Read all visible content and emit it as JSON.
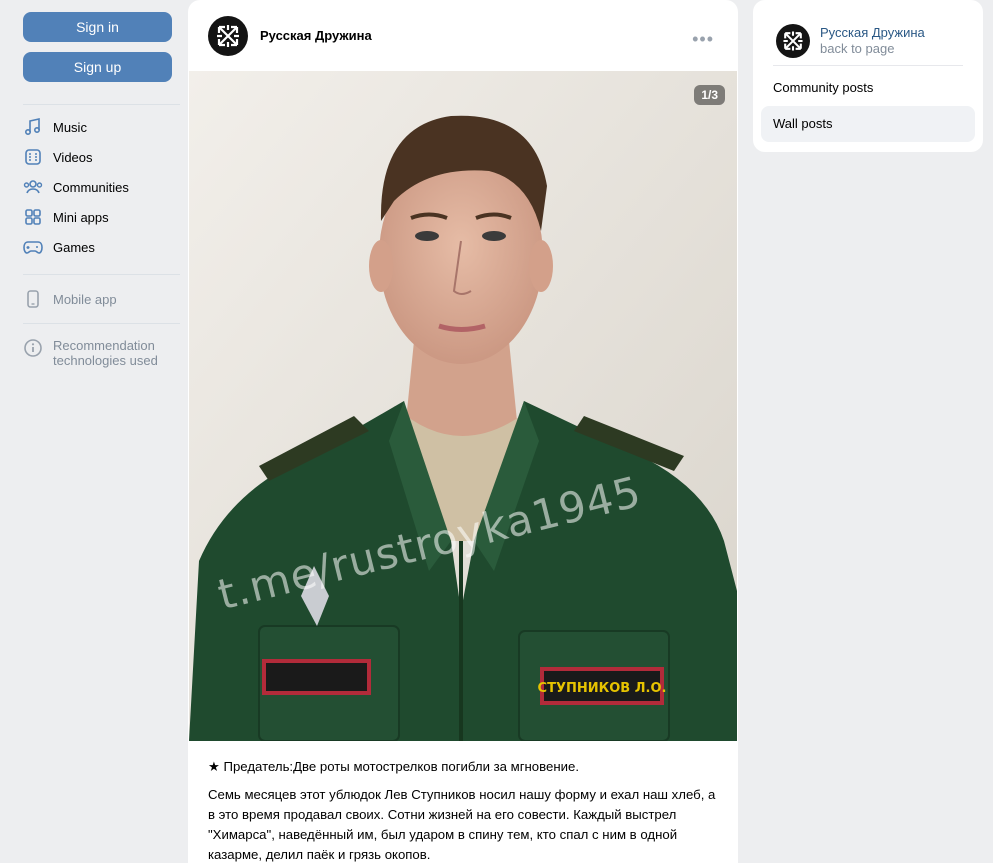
{
  "auth": {
    "sign_in": "Sign in",
    "sign_up": "Sign up"
  },
  "nav": [
    {
      "label": "Music",
      "icon": "music-icon"
    },
    {
      "label": "Videos",
      "icon": "video-icon"
    },
    {
      "label": "Communities",
      "icon": "communities-icon"
    },
    {
      "label": "Mini apps",
      "icon": "mini-apps-icon"
    },
    {
      "label": "Games",
      "icon": "games-icon"
    }
  ],
  "mobile_app": "Mobile app",
  "recommendation": "Recommendation technologies used",
  "post": {
    "author": "Русская Дружина",
    "photo_counter": "1/3",
    "watermark": "t.me/rustroyka1945",
    "headline": "★ Предатель:Две роты мотострелков погибли за мгновение.",
    "body": "Семь месяцев этот ублюдок Лев Ступников носил нашу форму и ехал наш хлеб, а в это время продавал своих. Сотни жизней на его совести. Каждый выстрел \"Химарса\", наведённый им, был ударом в спину тем, кто спал с ним в одной казарме, делил паёк и грязь окопов.",
    "name_tag": "СТУПНИКОВ Л.О."
  },
  "side": {
    "community": "Русская Дружина",
    "back": "back to page",
    "items": [
      "Community posts",
      "Wall posts"
    ],
    "active": "Wall posts"
  },
  "colors": {
    "accent": "#5181b8",
    "link": "#2a5885",
    "muted": "#818c99",
    "background": "#edeef0"
  }
}
